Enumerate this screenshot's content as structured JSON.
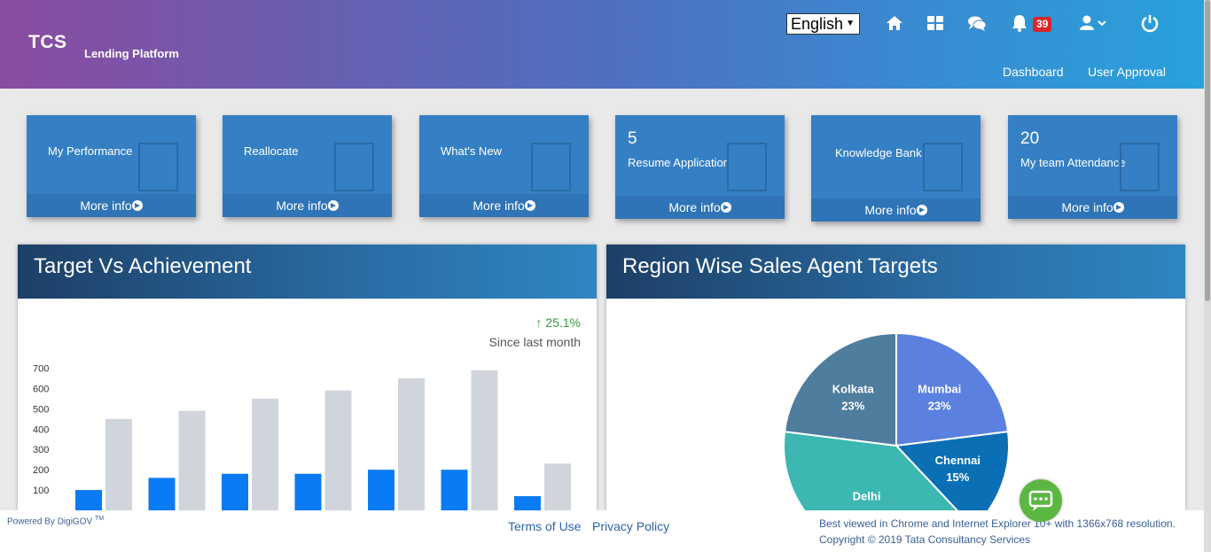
{
  "header": {
    "logo_main": "TCS",
    "logo_sub": "Lending Platform",
    "language": "English",
    "notification_count": "39",
    "nav": [
      "Dashboard",
      "User Approval"
    ]
  },
  "tiles": [
    {
      "number": "",
      "label": "My Performance",
      "more": "More info"
    },
    {
      "number": "",
      "label": "Reallocate",
      "more": "More info"
    },
    {
      "number": "",
      "label": "What's New",
      "more": "More info"
    },
    {
      "number": "5",
      "label": "Resume Application",
      "more": "More info"
    },
    {
      "number": "",
      "label": "Knowledge Bank",
      "more": "More info"
    },
    {
      "number": "20",
      "label": "My team Attendance",
      "more": "More info"
    }
  ],
  "target_panel": {
    "title": "Target Vs Achievement",
    "trend": "25.1%",
    "trend_caption": "Since last month"
  },
  "region_panel": {
    "title": "Region Wise Sales Agent Targets"
  },
  "chart_data": [
    {
      "type": "bar",
      "ylim": [
        0,
        700
      ],
      "yticks": [
        "700",
        "600",
        "500",
        "400",
        "300",
        "200",
        "100"
      ],
      "series": [
        {
          "values": [
            100,
            160,
            180,
            180,
            200,
            200,
            70
          ],
          "color": "#0a7bf2"
        },
        {
          "values": [
            450,
            490,
            550,
            590,
            650,
            690,
            230
          ],
          "color": "#d0d5dc"
        }
      ]
    },
    {
      "type": "pie",
      "labels": [
        "Mumbai",
        "Chennai",
        "Delhi",
        "Kolkata"
      ],
      "values": [
        23,
        15,
        39,
        23
      ],
      "value_labels": [
        "23%",
        "15%",
        "",
        "23%"
      ],
      "colors": [
        "#5b80e0",
        "#0b6fb5",
        "#3cb7b1",
        "#4f7d9d"
      ]
    }
  ],
  "footer": {
    "powered": "Powered By DigiGOV",
    "tm": "TM",
    "terms": "Terms of Use",
    "privacy": "Privacy Policy",
    "best_viewed": "Best viewed in Chrome and Internet Explorer 10+ with 1366x768 resolution.",
    "copyright": "Copyright © 2019 Tata Consultancy Services"
  }
}
